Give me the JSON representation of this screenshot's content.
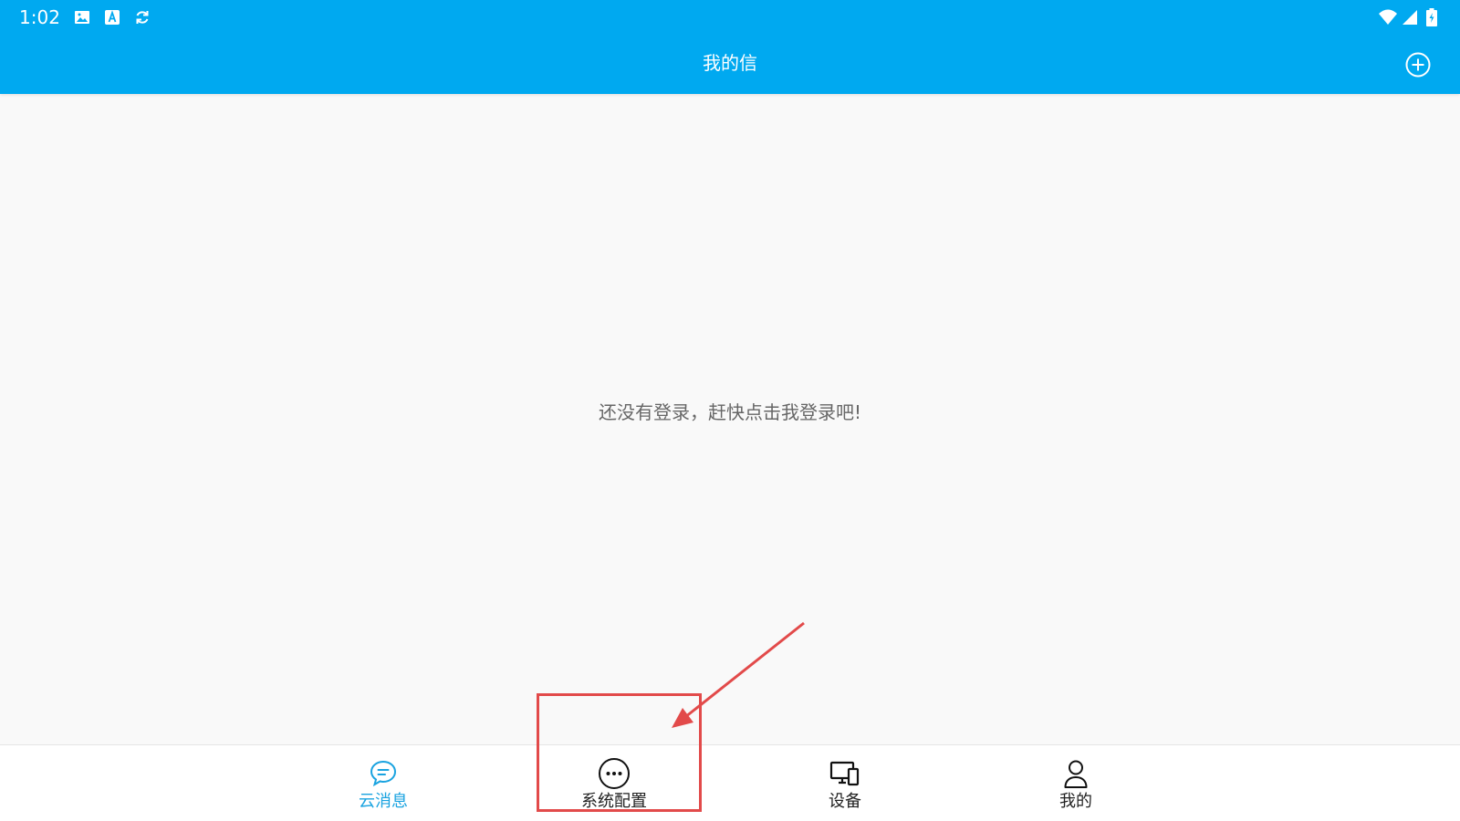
{
  "status_bar": {
    "time": "1:02",
    "icons": [
      "image-icon",
      "app-a-icon",
      "sync-icon",
      "wifi-icon",
      "signal-icon",
      "battery-charging-icon"
    ]
  },
  "app_bar": {
    "title": "我的信",
    "action_icon": "add-circle-icon"
  },
  "main": {
    "empty_message": "还没有登录，赶快点击我登录吧!"
  },
  "bottom_nav": {
    "items": [
      {
        "label": "云消息",
        "icon": "chat-bubble-icon",
        "active": true
      },
      {
        "label": "系统配置",
        "icon": "more-circle-icon",
        "active": false
      },
      {
        "label": "设备",
        "icon": "devices-icon",
        "active": false
      },
      {
        "label": "我的",
        "icon": "person-icon",
        "active": false
      }
    ]
  },
  "colors": {
    "primary": "#00a9f0",
    "active_tab": "#1aa3e0",
    "annotation": "#e24a4a",
    "background": "#f9f9f9"
  }
}
